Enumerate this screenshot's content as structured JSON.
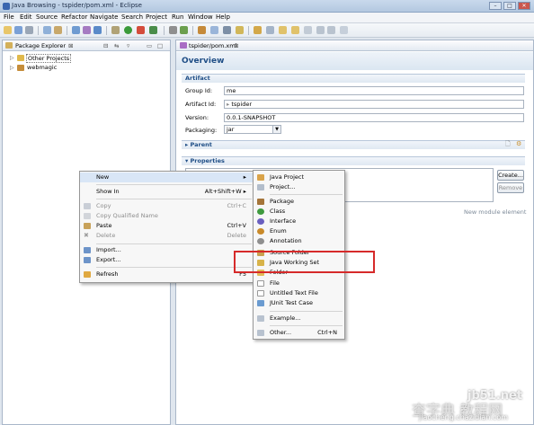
{
  "window": {
    "title": "Java Browsing - tspider/pom.xml - Eclipse",
    "controls": [
      "–",
      "□",
      "✕"
    ]
  },
  "menubar": [
    "File",
    "Edit",
    "Source",
    "Refactor",
    "Navigate",
    "Search",
    "Project",
    "Run",
    "Window",
    "Help"
  ],
  "package_explorer": {
    "tab_label": "Package Explorer",
    "items": [
      {
        "label": "Other Projects",
        "icon": "folder-icon"
      },
      {
        "label": "webmagic",
        "icon": "project-icon"
      }
    ]
  },
  "editor": {
    "tab_label": "tspider/pom.xml",
    "overview_title": "Overview",
    "artifact": {
      "section_label": "Artifact",
      "group_id_label": "Group Id:",
      "group_id_value": "me",
      "artifact_id_label": "Artifact Id:",
      "artifact_id_value": "tspider",
      "version_label": "Version:",
      "version_value": "0.0.1-SNAPSHOT",
      "packaging_label": "Packaging:",
      "packaging_value": "jar"
    },
    "parent_label": "Parent",
    "properties_label": "Properties",
    "create_button": "Create...",
    "remove_button": "Remove",
    "new_module_label": "New module element"
  },
  "context_menu": {
    "items": [
      {
        "label": "New",
        "accel": "",
        "disabled": false,
        "submenu": true
      },
      {
        "label": "Show In",
        "accel": "Alt+Shift+W ▸",
        "disabled": false
      },
      {
        "label": "Copy",
        "accel": "Ctrl+C",
        "disabled": true
      },
      {
        "label": "Copy Qualified Name",
        "accel": "",
        "disabled": true
      },
      {
        "label": "Paste",
        "accel": "Ctrl+V",
        "disabled": false
      },
      {
        "label": "Delete",
        "accel": "Delete",
        "disabled": true
      },
      {
        "label": "Import...",
        "accel": "",
        "disabled": false
      },
      {
        "label": "Export...",
        "accel": "",
        "disabled": false
      },
      {
        "label": "Refresh",
        "accel": "F5",
        "disabled": false
      }
    ]
  },
  "new_submenu": {
    "items": [
      {
        "label": "Java Project",
        "accel": ""
      },
      {
        "label": "Project...",
        "accel": ""
      },
      {
        "label": "Package",
        "accel": ""
      },
      {
        "label": "Class",
        "accel": ""
      },
      {
        "label": "Interface",
        "accel": ""
      },
      {
        "label": "Enum",
        "accel": ""
      },
      {
        "label": "Annotation",
        "accel": ""
      },
      {
        "label": "Source Folder",
        "accel": ""
      },
      {
        "label": "Java Working Set",
        "accel": ""
      },
      {
        "label": "Folder",
        "accel": ""
      },
      {
        "label": "File",
        "accel": ""
      },
      {
        "label": "Untitled Text File",
        "accel": ""
      },
      {
        "label": "JUnit Test Case",
        "accel": ""
      },
      {
        "label": "Example...",
        "accel": ""
      },
      {
        "label": "Other...",
        "accel": "Ctrl+N"
      }
    ]
  },
  "watermark": {
    "line1": "jb51.net",
    "line2": "查字典 教程网",
    "line3": "jiaocheng.chazidian.com"
  },
  "colors": {
    "highlight_box": "#d62a2a",
    "section_title": "#1f4e86"
  }
}
